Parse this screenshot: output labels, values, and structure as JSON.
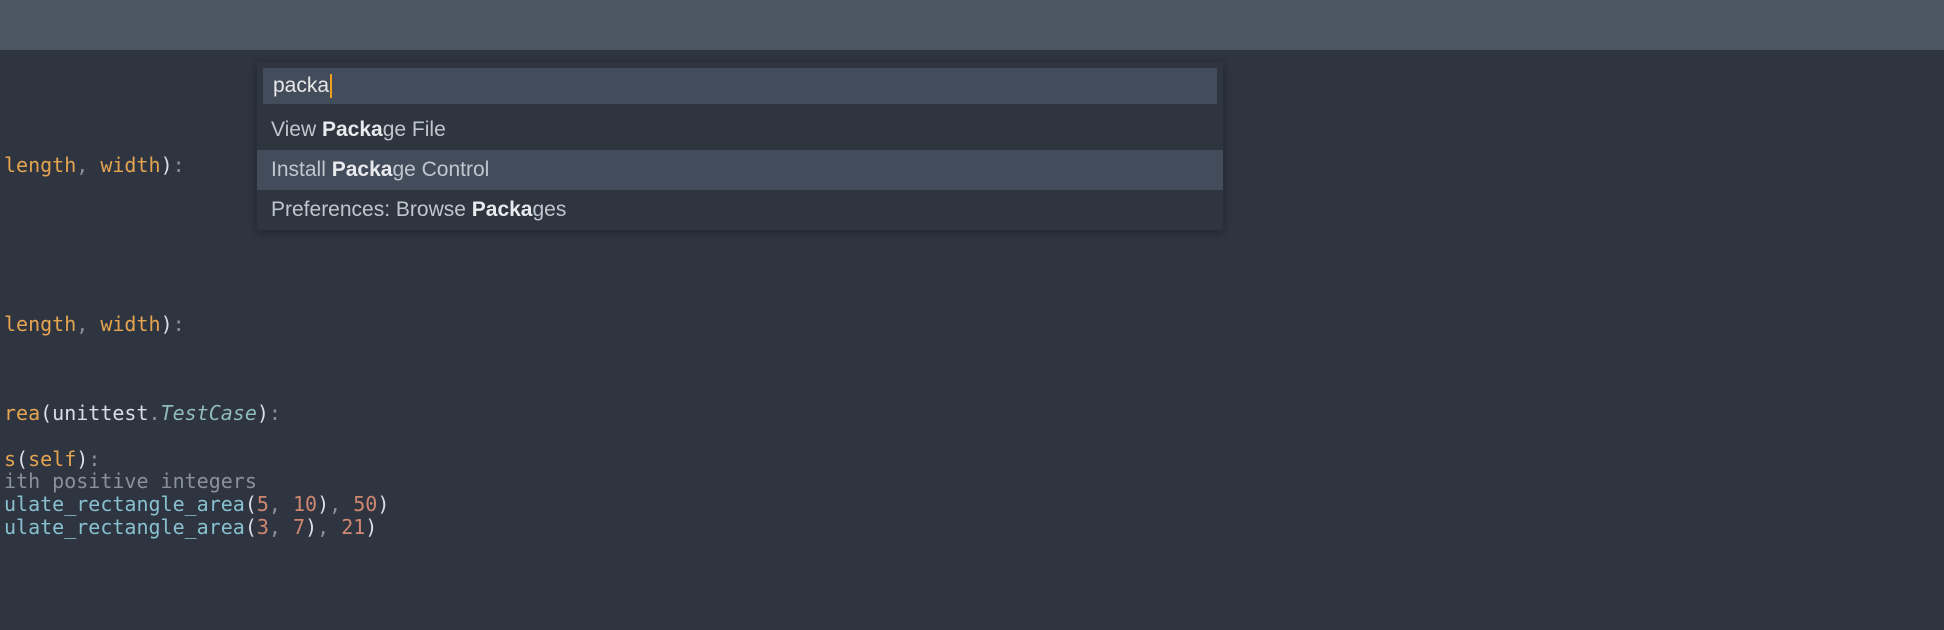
{
  "palette": {
    "input": "packa",
    "results": [
      {
        "prefix": "View ",
        "match": "Packa",
        "suffix": "ge File",
        "highlighted": false
      },
      {
        "prefix": "Install ",
        "match": "Packa",
        "suffix": "ge Control",
        "highlighted": true
      },
      {
        "prefix": "Preferences: Browse ",
        "match": "Packa",
        "suffix": "ges",
        "highlighted": false
      }
    ]
  },
  "code": {
    "line1_a": "length",
    "line1_b": ", ",
    "line1_c": "width",
    "line1_d": ")",
    "line1_e": ":",
    "line2_a": "length",
    "line2_b": ", ",
    "line2_c": "width",
    "line2_d": ")",
    "line2_e": ":",
    "line3_a": "rea",
    "line3_b": "(",
    "line3_c": "unittest",
    "line3_d": ".",
    "line3_e": "TestCase",
    "line3_f": ")",
    "line3_g": ":",
    "line4_a": "s",
    "line4_b": "(",
    "line4_c": "self",
    "line4_d": ")",
    "line4_e": ":",
    "line5": "ith positive integers",
    "line6_a": "ulate_rectangle_area",
    "line6_b": "(",
    "line6_c": "5",
    "line6_d": ", ",
    "line6_e": "10",
    "line6_f": ")",
    "line6_g": ", ",
    "line6_h": "50",
    "line6_i": ")",
    "line7_a": "ulate_rectangle_area",
    "line7_b": "(",
    "line7_c": "3",
    "line7_d": ", ",
    "line7_e": "7",
    "line7_f": ")",
    "line7_g": ", ",
    "line7_h": "21",
    "line7_i": ")"
  }
}
